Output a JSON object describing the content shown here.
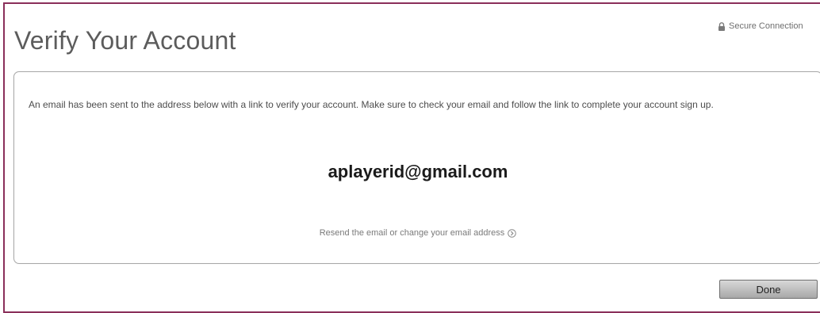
{
  "header": {
    "secure_label": "Secure Connection",
    "title": "Verify Your Account"
  },
  "panel": {
    "message": "An email has been sent to the address below with a link to verify your account. Make sure to check your email and follow the link to complete your account sign up.",
    "email": "aplayerid@gmail.com",
    "resend_label": "Resend the email or change your email address"
  },
  "footer": {
    "done_label": "Done"
  },
  "icons": {
    "secure": "lock-icon",
    "resend": "circle-arrow-right-icon"
  },
  "colors": {
    "frame_border": "#8a2f5a",
    "title_text": "#5c5c5c",
    "panel_border": "#a9a9a9"
  }
}
